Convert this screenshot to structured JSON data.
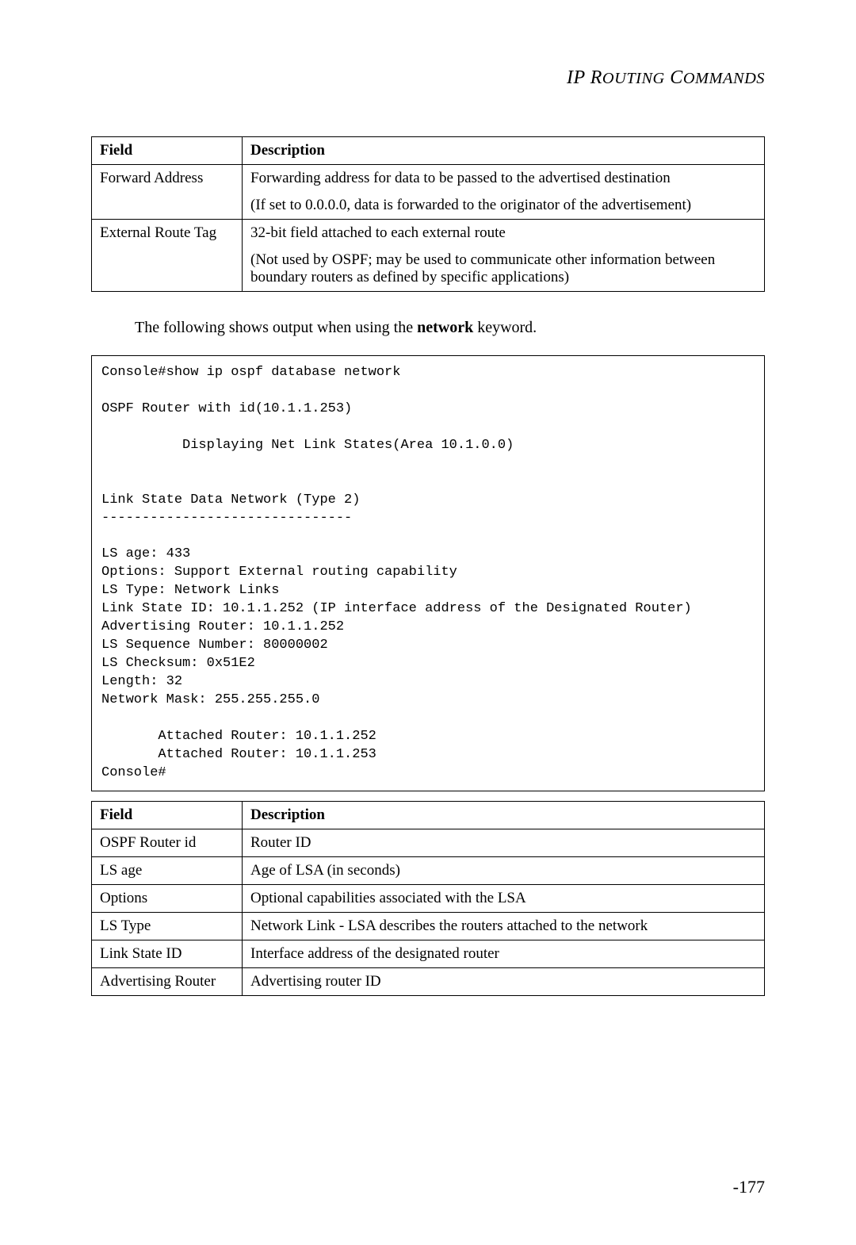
{
  "header": {
    "title_part1": "IP R",
    "title_part2": "OUTING",
    "title_part3": " C",
    "title_part4": "OMMANDS"
  },
  "table1": {
    "headers": {
      "field": "Field",
      "description": "Description"
    },
    "rows": [
      {
        "field": "Forward Address",
        "description_p1": "Forwarding address for data to be passed to the advertised destination",
        "description_p2": "(If set to 0.0.0.0, data is forwarded to the originator of the advertisement)"
      },
      {
        "field": "External Route Tag",
        "description_p1": "32-bit field attached to each external route",
        "description_p2": "(Not used by OSPF; may be used to communicate other information between boundary routers as defined by specific applications)"
      }
    ]
  },
  "paragraph": {
    "pre": "The following shows output when using the ",
    "bold": "network",
    "post": " keyword."
  },
  "console": "Console#show ip ospf database network\n\nOSPF Router with id(10.1.1.253)\n\n          Displaying Net Link States(Area 10.1.0.0)\n\n\nLink State Data Network (Type 2)\n-------------------------------\n\nLS age: 433\nOptions: Support External routing capability\nLS Type: Network Links\nLink State ID: 10.1.1.252 (IP interface address of the Designated Router)\nAdvertising Router: 10.1.1.252\nLS Sequence Number: 80000002\nLS Checksum: 0x51E2\nLength: 32\nNetwork Mask: 255.255.255.0\n\n       Attached Router: 10.1.1.252\n       Attached Router: 10.1.1.253\nConsole#",
  "table2": {
    "headers": {
      "field": "Field",
      "description": "Description"
    },
    "rows": [
      {
        "field": "OSPF Router id",
        "description": "Router ID"
      },
      {
        "field": "LS age",
        "description": "Age of LSA (in seconds)"
      },
      {
        "field": "Options",
        "description": "Optional capabilities associated with the LSA"
      },
      {
        "field": "LS Type",
        "description": "Network Link - LSA describes the routers attached to the network"
      },
      {
        "field": "Link State ID",
        "description": "Interface address of the designated router"
      },
      {
        "field": "Advertising Router",
        "description": "Advertising router ID"
      }
    ]
  },
  "page_number": "-177"
}
